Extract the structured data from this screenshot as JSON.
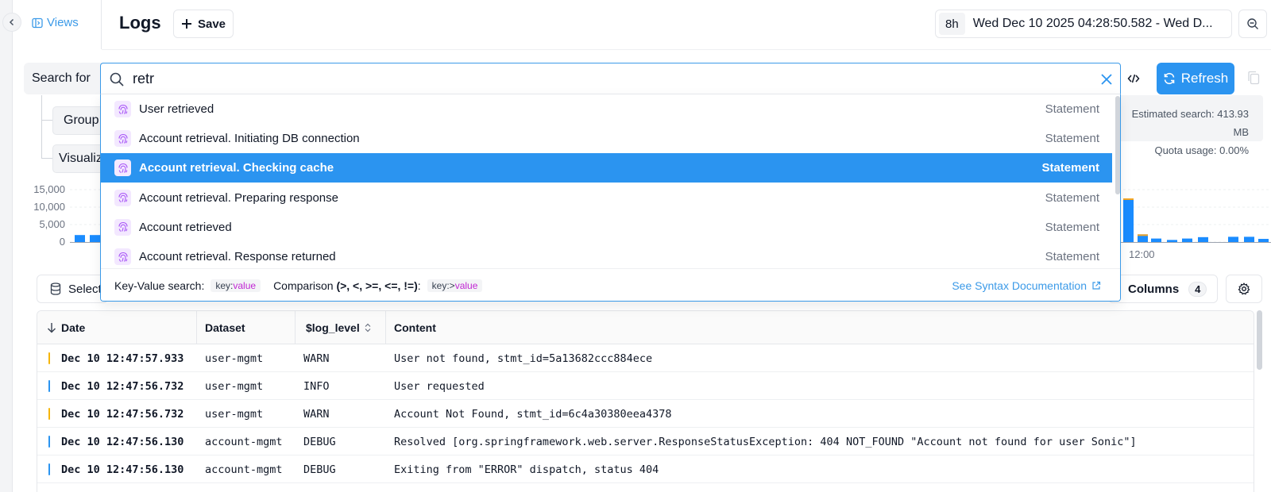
{
  "sidebar": {
    "views_label": "Views"
  },
  "header": {
    "title": "Logs",
    "save_label": "Save",
    "time_range_badge": "8h",
    "time_range_text": "Wed Dec 10 2025 04:28:50.582 - Wed D..."
  },
  "search": {
    "label": "Search for",
    "value": "retr",
    "refresh_label": "Refresh"
  },
  "controls": {
    "group_label": "Group",
    "visualize_label": "Visualiz",
    "estimated_search": "Estimated search: 413.93 MB",
    "quota_usage": "Quota usage: 0.00%",
    "select_label": "Select",
    "columns_label": "Columns",
    "columns_count": "4"
  },
  "chart_data": {
    "type": "bar",
    "y_ticks": [
      "15,000",
      "10,000",
      "5,000",
      "0"
    ],
    "ylim": [
      0,
      15000
    ],
    "x_tick_label": "12:00",
    "colors": {
      "primary": "#1a8cff",
      "warn": "#f5a623"
    }
  },
  "suggestions": [
    {
      "text": "User retrieved",
      "type": "Statement",
      "active": false
    },
    {
      "text": "Account retrieval. Initiating DB connection",
      "type": "Statement",
      "active": false
    },
    {
      "text": "Account retrieval. Checking cache",
      "type": "Statement",
      "active": true
    },
    {
      "text": "Account retrieval. Preparing response",
      "type": "Statement",
      "active": false
    },
    {
      "text": "Account retrieved",
      "type": "Statement",
      "active": false
    },
    {
      "text": "Account retrieval. Response returned",
      "type": "Statement",
      "active": false
    }
  ],
  "dropdown_footer": {
    "kv_label": "Key-Value search:",
    "kv_key": "key:",
    "kv_value": "value",
    "cmp_label_prefix": "Comparison ",
    "cmp_ops": "(>, <, >=, <=, !=)",
    "cmp_label_suffix": ":",
    "cmp_key": "key:>",
    "cmp_value": "value",
    "syntax_link": "See Syntax Documentation"
  },
  "table": {
    "columns": [
      "Date",
      "Dataset",
      "$log_level",
      "Content"
    ],
    "rows": [
      {
        "date": "Dec 10 12:47:57.933",
        "dataset": "user-mgmt",
        "level": "WARN",
        "content": "User not found, stmt_id=5a13682ccc884ece"
      },
      {
        "date": "Dec 10 12:47:56.732",
        "dataset": "user-mgmt",
        "level": "INFO",
        "content": "User requested"
      },
      {
        "date": "Dec 10 12:47:56.732",
        "dataset": "user-mgmt",
        "level": "WARN",
        "content": "Account Not Found, stmt_id=6c4a30380eea4378"
      },
      {
        "date": "Dec 10 12:47:56.130",
        "dataset": "account-mgmt",
        "level": "DEBUG",
        "content": "Resolved [org.springframework.web.server.ResponseStatusException: 404 NOT_FOUND \"Account not found for user Sonic\"]"
      },
      {
        "date": "Dec 10 12:47:56.130",
        "dataset": "account-mgmt",
        "level": "DEBUG",
        "content": "Exiting from \"ERROR\" dispatch, status 404"
      }
    ]
  },
  "level_colors": {
    "WARN": "#f5b50a",
    "INFO": "#2b94f0",
    "DEBUG": "#2b94f0"
  }
}
